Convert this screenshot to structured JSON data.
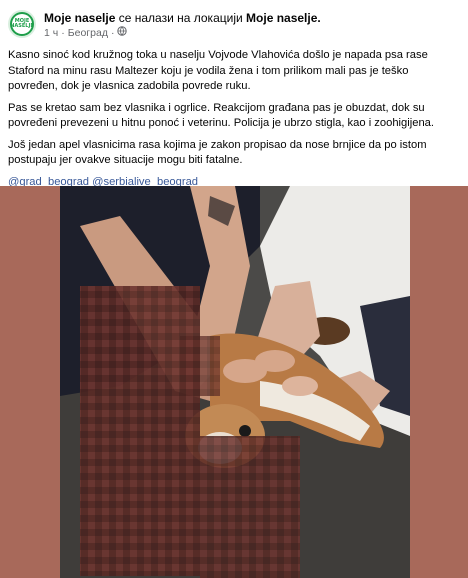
{
  "post": {
    "page_name": "Moje naselje",
    "location_prefix": "се налази на локацији",
    "location_name": "Moje naselje.",
    "time": "1 ч",
    "place": "Београд",
    "avatar_text": "MOJE NASELJE",
    "paragraphs": [
      "Kasno sinoć kod kružnog toka u naselju Vojvode Vlahovića došlo je napada psa rase Staford na minu rasu Maltezer koju je vodila žena i tom prilikom mali pas je teško povređen, dok je vlasnica zadobila povrede ruku.",
      "Pas se kretao sam bez vlasnika i ogrlice. Reakcijom građana pas je obuzdat, dok su povređeni prevezeni u hitnu ponoć i veterinu. Policija je ubrzo stigla, kao i zoohigijena.",
      "Još jedan apel vlasnicima rasa kojima je zakon propisao da nose brnjice da po istom postupaju jer ovakve situacije mogu biti fatalne."
    ],
    "hashtags": "@grad_beograd @serbialive_beograd"
  },
  "colors": {
    "brand_green": "#1e9e4a",
    "link": "#385898",
    "photo_frame": "#a8695a"
  }
}
